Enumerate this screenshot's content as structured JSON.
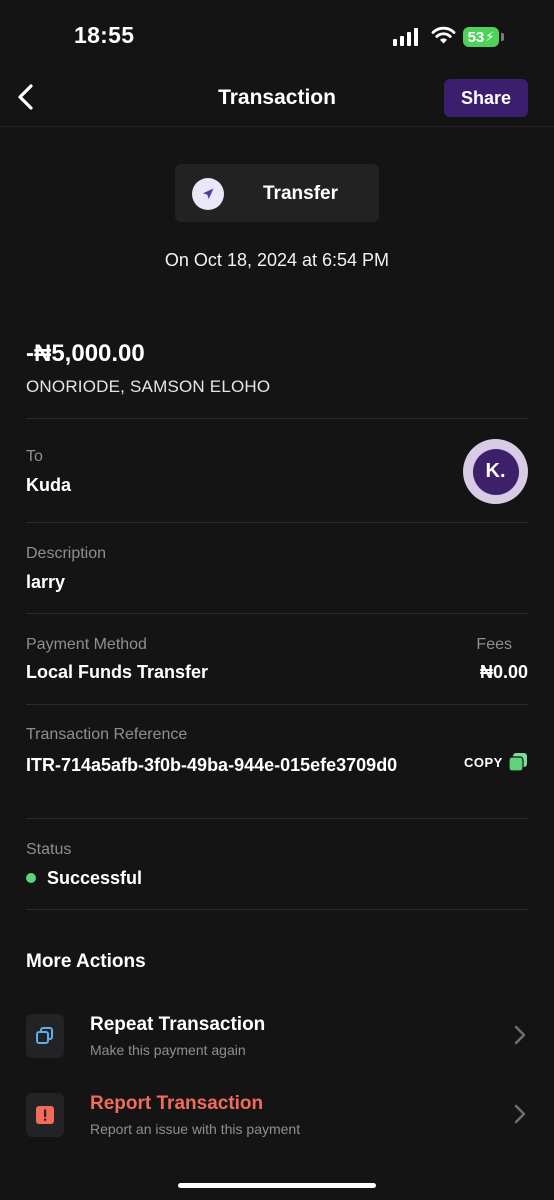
{
  "status_bar": {
    "time": "18:55",
    "battery": "53"
  },
  "header": {
    "title": "Transaction",
    "share_label": "Share"
  },
  "type": {
    "label": "Transfer"
  },
  "date": "On Oct 18, 2024 at 6:54 PM",
  "amount": "-₦5,000.00",
  "counterparty": "ONORIODE, SAMSON ELOHO",
  "to": {
    "label": "To",
    "value": "Kuda",
    "logo_text": "K."
  },
  "description": {
    "label": "Description",
    "value": "larry"
  },
  "payment_method": {
    "label": "Payment Method",
    "value": "Local Funds Transfer"
  },
  "fees": {
    "label": "Fees",
    "value": "₦0.00"
  },
  "reference": {
    "label": "Transaction Reference",
    "value": "ITR-714a5afb-3f0b-49ba-944e-015efe3709d0",
    "copy_label": "COPY"
  },
  "status": {
    "label": "Status",
    "value": "Successful",
    "color": "#5fd37b"
  },
  "more_actions": {
    "title": "More Actions",
    "repeat": {
      "title": "Repeat Transaction",
      "subtitle": "Make this payment again",
      "icon": "copy-icon"
    },
    "report": {
      "title": "Report Transaction",
      "subtitle": "Report an issue with this payment",
      "icon": "alert-icon",
      "color": "#f26b5b"
    }
  },
  "colors": {
    "accent": "#3b1f6e",
    "background": "#141414",
    "success": "#5fd37b",
    "danger": "#f26b5b"
  }
}
